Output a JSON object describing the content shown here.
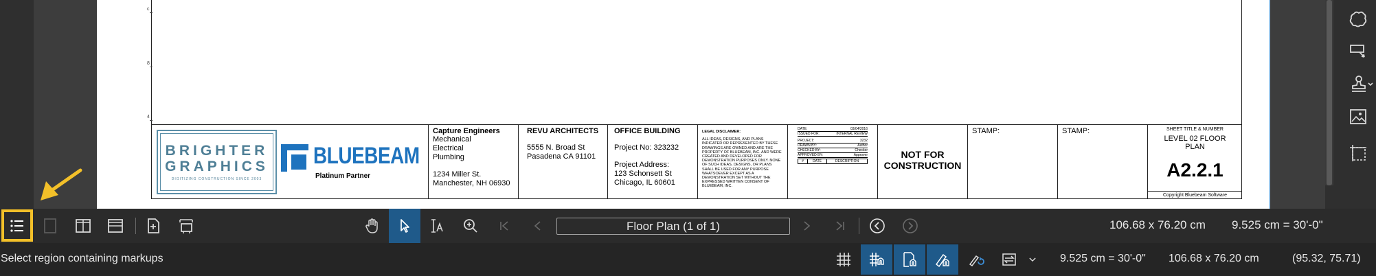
{
  "document": {
    "ruler_numbers": [
      "c",
      "8",
      "4"
    ],
    "title_block": {
      "engineers": {
        "name": "Capture Engineers",
        "disciplines": [
          "Mechanical",
          "Electrical",
          "Plumbing"
        ],
        "address_line1": "1234 Miller St.",
        "address_line2": "Manchester, NH 06930"
      },
      "architects": {
        "name": "REVU ARCHITECTS",
        "address_line1": "5555 N. Broad St",
        "address_line2": "Pasadena CA 91101"
      },
      "project": {
        "name": "OFFICE BUILDING",
        "number": "Project No: 323232",
        "address_label": "Project Address:",
        "address_line1": "123 Schonsett St",
        "address_line2": "Chicago, IL 60601"
      },
      "legal": {
        "heading": "LEGAL DISCLAIMER:",
        "body": "ALL IDEAS, DESIGNS, AND PLANS INDICATED OR REPRESENTED BY THESE DRAWINGS ARE OWNED AND ARE THE PROPERTY OF BLUEBEAM, INC. AND WERE CREATED AND DEVELOPED FOR DEMONSTRATION PURPOSES ONLY. NONE OF SUCH IDEAS, DESIGNS, OR PLANS SHALL BE USED FOR ANY PURPOSE WHATSOEVER EXCEPT AS A DEMONSTRATION SET WITHOUT THE EXPRESSED WRITTEN CONSENT OF BLUEBEAM, INC."
      },
      "issue_table": {
        "rows": [
          {
            "label": "DATE:",
            "value": "03/04/2016"
          },
          {
            "label": "ISSUED FOR:",
            "value": "INTERNAL REVIEW"
          },
          {
            "label": "PROJECT:",
            "value": "3232"
          },
          {
            "label": "DRAWN BY:",
            "value": "Author"
          },
          {
            "label": "CHECKED BY:",
            "value": "Checker"
          },
          {
            "label": "APPROVED BY:",
            "value": "Approver"
          }
        ],
        "footer": [
          "#",
          "DATE",
          "DESCRIPTION"
        ]
      },
      "not_for_construction": "NOT FOR CONSTRUCTION",
      "stamp1": "STAMP:",
      "stamp2": "STAMP:",
      "sheet": {
        "label": "SHEET TITLE & NUMBER",
        "title": "LEVEL 02 FLOOR PLAN",
        "number": "A2.2.1",
        "copyright": "Copyright Bluebeam Software"
      },
      "logos": {
        "brighter_line1": "BRIGHTER",
        "brighter_line2": "GRAPHICS",
        "brighter_tagline": "DIGITIZING CONSTRUCTION SINCE 2003",
        "bluebeam_word": "BLUEBEAM",
        "bluebeam_sub": "Platinum Partner"
      }
    }
  },
  "toolbar": {
    "page_nav_label": "Floor Plan (1 of 1)",
    "page_size": "106.68 x 76.20 cm",
    "scale": "9.525 cm = 30'-0\""
  },
  "statusbar": {
    "message": "Select region containing markups",
    "scale": "9.525 cm = 30'-0\"",
    "page_size": "106.68 x 76.20 cm",
    "cursor_coords": "(95.32, 75.71)"
  },
  "colors": {
    "accent_active": "#1f5a8a",
    "highlight": "#f3c029",
    "bluebeam_blue": "#1e73be",
    "brighter_teal": "#4f7f96"
  }
}
